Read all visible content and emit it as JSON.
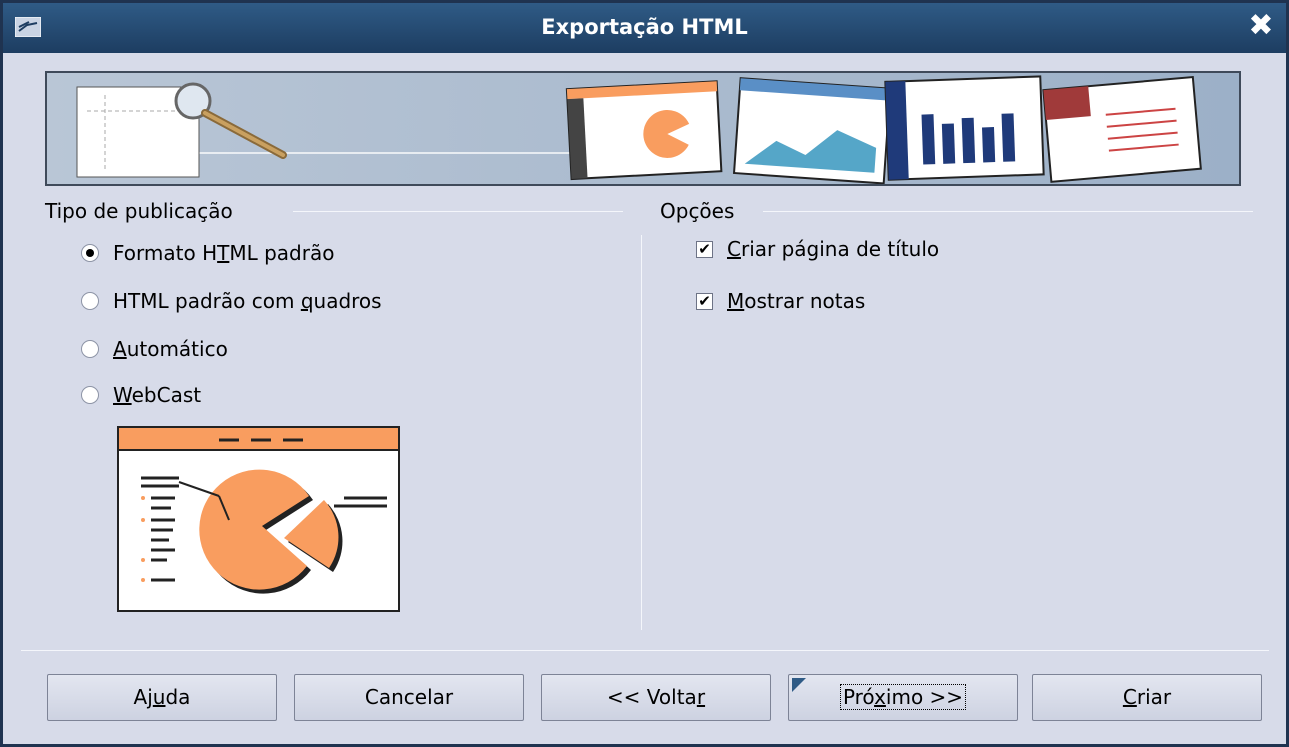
{
  "window": {
    "title": "Exportação HTML",
    "close_glyph": "✖"
  },
  "publication": {
    "label": "Tipo de publicação",
    "options": [
      {
        "pre": "Formato H",
        "ul": "T",
        "post": "ML padrão",
        "selected": true
      },
      {
        "pre": "HTML padrão com ",
        "ul": "q",
        "post": "uadros",
        "selected": false
      },
      {
        "pre": "",
        "ul": "A",
        "post": "utomático",
        "selected": false
      },
      {
        "pre": "",
        "ul": "W",
        "post": "ebCast",
        "selected": false
      }
    ]
  },
  "options": {
    "label": "Opções",
    "items": [
      {
        "pre": "",
        "ul": "C",
        "post": "riar página de título",
        "checked": true
      },
      {
        "pre": "",
        "ul": "M",
        "post": "ostrar notas",
        "checked": true
      }
    ]
  },
  "buttons": {
    "help": {
      "pre": "Aj",
      "ul": "u",
      "post": "da"
    },
    "cancel": {
      "label": "Cancelar"
    },
    "back": {
      "pre": "<< Volta",
      "ul": "r",
      "post": ""
    },
    "next": {
      "pre": "Pró",
      "ul": "x",
      "post": "imo >>"
    },
    "create": {
      "pre": "",
      "ul": "C",
      "post": "riar"
    }
  },
  "colors": {
    "accent_orange": "#f99d5f",
    "title_bar": "#1d3d61",
    "dialog_bg": "#d7dbe9"
  }
}
